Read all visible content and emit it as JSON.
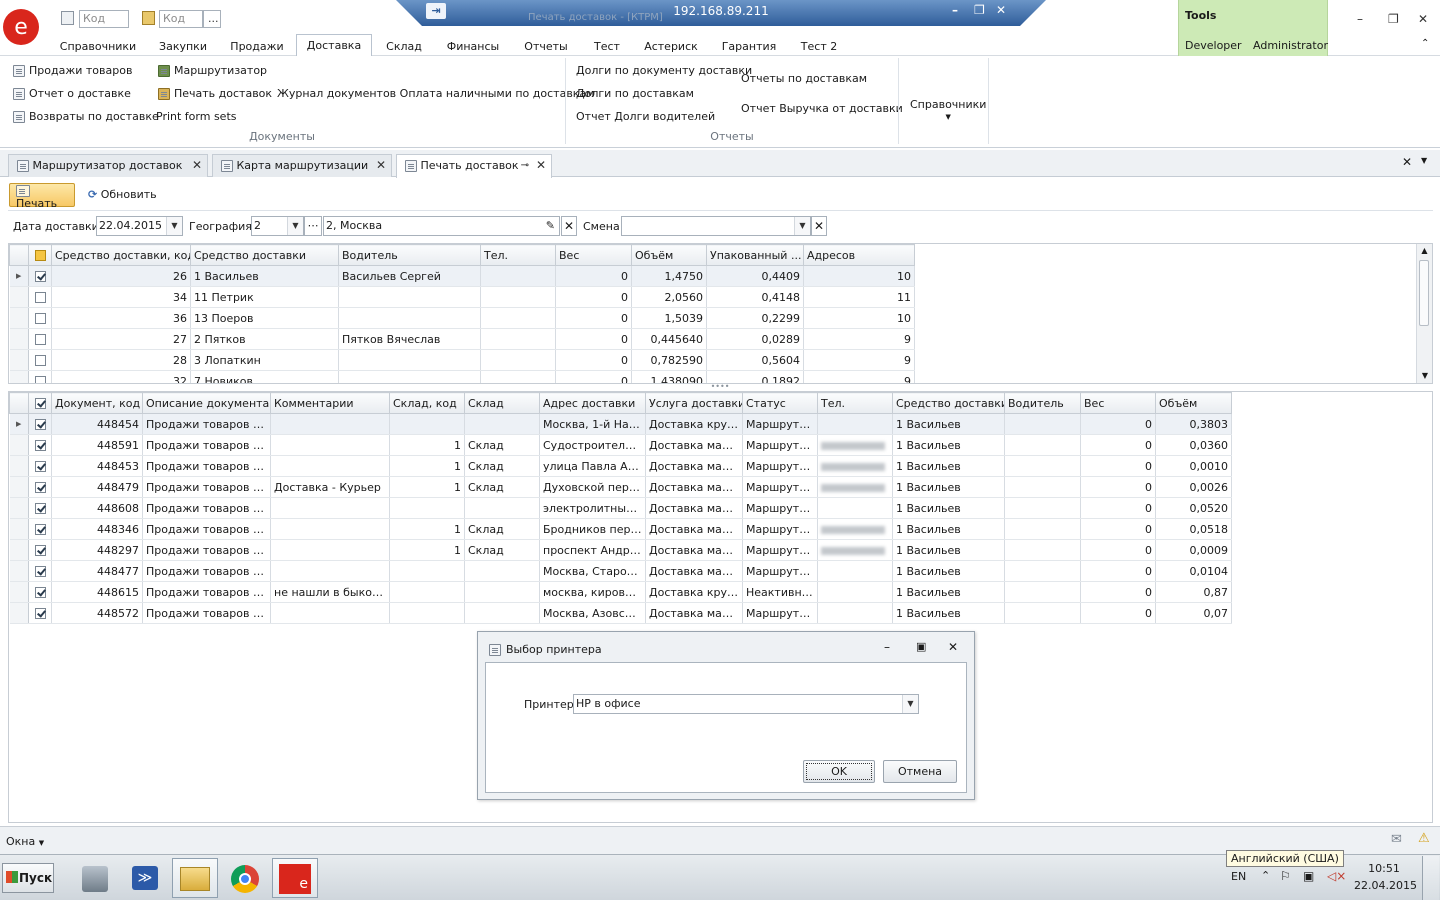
{
  "remote": {
    "ip": "192.168.89.211",
    "title": "Печать доставок - [КТРМ]"
  },
  "quick_access": {
    "code1_placeholder": "Код",
    "code2_placeholder": "Код",
    "more": "..."
  },
  "ribbon_tabs": [
    "Справочники",
    "Закупки",
    "Продажи",
    "Доставка",
    "Склад",
    "Финансы",
    "Отчеты",
    "Тест",
    "Астериск",
    "Гарантия",
    "Тест 2"
  ],
  "active_tab": "Доставка",
  "tools": {
    "title": "Tools",
    "developer": "Developer",
    "administrator": "Administrator"
  },
  "ribbon": {
    "col1": [
      "Продажи товаров",
      "Отчет о доставке",
      "Возвраты по доставке"
    ],
    "col2": [
      "Маршрутизатор",
      "Печать доставок",
      "Print form sets"
    ],
    "journal": "Журнал документов Оплата наличными по доставкам",
    "group_documents": "Документы",
    "col3": [
      "Долги по документу доставки",
      "Долги по доставкам",
      "Отчет Долги водителей"
    ],
    "col4": [
      "Отчеты по доставкам",
      "Отчет Выручка от доставки"
    ],
    "group_reports": "Отчеты",
    "refs": "Справочники"
  },
  "doc_tabs": [
    "Маршрутизатор доставок",
    "Карта маршрутизации",
    "Печать доставок"
  ],
  "toolbar": {
    "print": "Печать",
    "refresh": "Обновить"
  },
  "filters": {
    "date_label": "Дата доставки",
    "date_value": "22.04.2015",
    "geo_label": "География",
    "geo_code": "2",
    "geo_name": "2, Москва",
    "shift_label": "Смена",
    "shift_value": ""
  },
  "grid1": {
    "columns": [
      "Средство доставки, код",
      "Средство доставки",
      "Водитель",
      "Тел.",
      "Вес",
      "Объём",
      "Упакованный ...",
      "Адресов"
    ],
    "rows": [
      {
        "checked": true,
        "code": "26",
        "name": "1 Васильев",
        "driver": "Васильев Сергей",
        "tel": "",
        "weight": "0",
        "volume": "1,4750",
        "packed": "0,4409",
        "addresses": "10"
      },
      {
        "checked": false,
        "code": "34",
        "name": "11 Петрик",
        "driver": "",
        "tel": "",
        "weight": "0",
        "volume": "2,0560",
        "packed": "0,4148",
        "addresses": "11"
      },
      {
        "checked": false,
        "code": "36",
        "name": "13 Поеров",
        "driver": "",
        "tel": "",
        "weight": "0",
        "volume": "1,5039",
        "packed": "0,2299",
        "addresses": "10"
      },
      {
        "checked": false,
        "code": "27",
        "name": "2 Пятков",
        "driver": "Пятков Вячеслав",
        "tel": "",
        "weight": "0",
        "volume": "0,445640",
        "packed": "0,0289",
        "addresses": "9"
      },
      {
        "checked": false,
        "code": "28",
        "name": "3 Лопаткин",
        "driver": "",
        "tel": "",
        "weight": "0",
        "volume": "0,782590",
        "packed": "0,5604",
        "addresses": "9"
      },
      {
        "checked": false,
        "code": "32",
        "name": "7 Новиков",
        "driver": "",
        "tel": "",
        "weight": "0",
        "volume": "1,438090",
        "packed": "0,1892",
        "addresses": "9"
      }
    ]
  },
  "grid2": {
    "columns": [
      "Документ, код",
      "Описание документа",
      "Комментарии",
      "Склад, код",
      "Склад",
      "Адрес доставки",
      "Услуга доставки",
      "Статус",
      "Тел.",
      "Средство доставки",
      "Водитель",
      "Вес",
      "Объём"
    ],
    "rows": [
      {
        "checked": true,
        "doc": "448454",
        "desc": "Продажи товаров (Н...",
        "comment": "",
        "wh_code": "",
        "wh": "",
        "addr": "Москва, 1-й Нага...",
        "service": "Доставка круп...",
        "status": "Маршрутиз...",
        "tel": "",
        "vehicle": "1 Васильев",
        "driver": "",
        "weight": "0",
        "volume": "0,3803"
      },
      {
        "checked": true,
        "doc": "448591",
        "desc": "Продажи товаров (П...",
        "comment": "",
        "wh_code": "1",
        "wh": "Склад",
        "addr": "Судостроительн...",
        "service": "Доставка мало...",
        "status": "Маршрутиз...",
        "tel": "blur",
        "vehicle": "1 Васильев",
        "driver": "",
        "weight": "0",
        "volume": "0,0360"
      },
      {
        "checked": true,
        "doc": "448453",
        "desc": "Продажи товаров (П...",
        "comment": "",
        "wh_code": "1",
        "wh": "Склад",
        "addr": "улица Павла Анд...",
        "service": "Доставка мало...",
        "status": "Маршрутиз...",
        "tel": "blur",
        "vehicle": "1 Васильев",
        "driver": "",
        "weight": "0",
        "volume": "0,0010"
      },
      {
        "checked": true,
        "doc": "448479",
        "desc": "Продажи товаров (П...",
        "comment": "Доставка - Курьер",
        "wh_code": "1",
        "wh": "Склад",
        "addr": "Духовской переу...",
        "service": "Доставка мало...",
        "status": "Маршрутиз...",
        "tel": "blur",
        "vehicle": "1 Васильев",
        "driver": "",
        "weight": "0",
        "volume": "0,0026"
      },
      {
        "checked": true,
        "doc": "448608",
        "desc": "Продажи товаров (Н...",
        "comment": "",
        "wh_code": "",
        "wh": "",
        "addr": "электролитный п...",
        "service": "Доставка мало...",
        "status": "Маршрутиз...",
        "tel": "",
        "vehicle": "1 Васильев",
        "driver": "",
        "weight": "0",
        "volume": "0,0520"
      },
      {
        "checked": true,
        "doc": "448346",
        "desc": "Продажи товаров (П...",
        "comment": "",
        "wh_code": "1",
        "wh": "Склад",
        "addr": "Бродников переу...",
        "service": "Доставка мало...",
        "status": "Маршрутиз...",
        "tel": "blur",
        "vehicle": "1 Васильев",
        "driver": "",
        "weight": "0",
        "volume": "0,0518"
      },
      {
        "checked": true,
        "doc": "448297",
        "desc": "Продажи товаров (П...",
        "comment": "",
        "wh_code": "1",
        "wh": "Склад",
        "addr": "проспект Андроп...",
        "service": "Доставка мало...",
        "status": "Маршрутиз...",
        "tel": "blur",
        "vehicle": "1 Васильев",
        "driver": "",
        "weight": "0",
        "volume": "0,0009"
      },
      {
        "checked": true,
        "doc": "448477",
        "desc": "Продажи товаров (Н...",
        "comment": "",
        "wh_code": "",
        "wh": "",
        "addr": " Москва, Староб...",
        "service": "Доставка мало...",
        "status": "Маршрутиз...",
        "tel": "",
        "vehicle": "1 Васильев",
        "driver": "",
        "weight": "0",
        "volume": "0,0104"
      },
      {
        "checked": true,
        "doc": "448615",
        "desc": "Продажи товаров (О...",
        "comment": "не нашли в быково,...",
        "wh_code": "",
        "wh": "",
        "addr": "москва, кировог...",
        "service": "Доставка круп...",
        "status": "Неактивная",
        "tel": "",
        "vehicle": "1 Васильев",
        "driver": "",
        "weight": "0",
        "volume": "0,87"
      },
      {
        "checked": true,
        "doc": "448572",
        "desc": "Продажи товаров (П...",
        "comment": "",
        "wh_code": "",
        "wh": "",
        "addr": "Москва, Азовска...",
        "service": "Доставка мало...",
        "status": "Маршрутиз...",
        "tel": "",
        "vehicle": "1 Васильев",
        "driver": "",
        "weight": "0",
        "volume": "0,07"
      }
    ]
  },
  "dialog": {
    "title": "Выбор принтера",
    "printer_label": "Принтер",
    "printer_value": "HP в офисе",
    "ok": "OK",
    "cancel": "Отмена"
  },
  "statusbar": {
    "windows": "Окна"
  },
  "taskbar": {
    "start": "Пуск",
    "lang": "EN",
    "lang_tooltip": "Английский (США)",
    "time": "10:51",
    "date": "22.04.2015"
  }
}
